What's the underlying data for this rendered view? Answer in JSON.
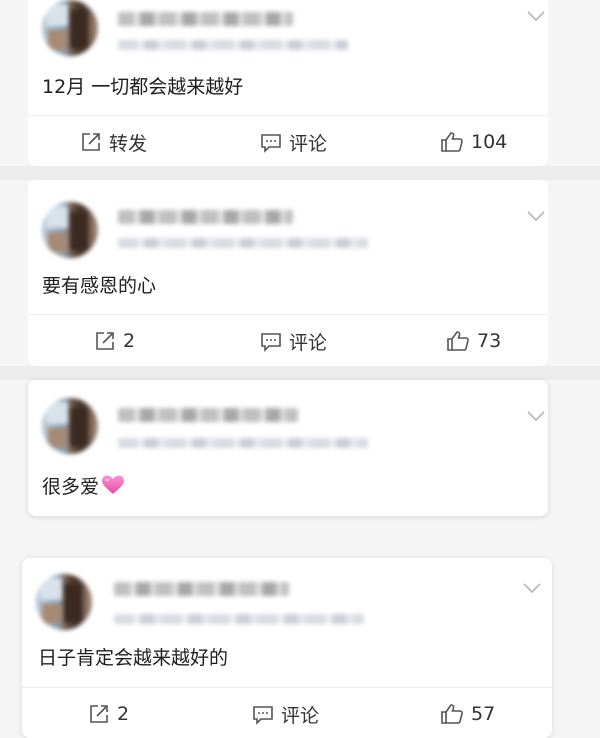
{
  "posts": [
    {
      "text": "12月 一切都会越来越好",
      "actions": {
        "repost": "转发",
        "comment": "评论",
        "like": "104"
      }
    },
    {
      "text": "要有感恩的心",
      "actions": {
        "repost": "2",
        "comment": "评论",
        "like": "73"
      }
    },
    {
      "text": "很多爱",
      "emoji": "pink-heart-emoji"
    },
    {
      "text": "日子肯定会越来越好的",
      "actions": {
        "repost": "2",
        "comment": "评论",
        "like": "57"
      }
    }
  ],
  "icons": {
    "repost": "repost-icon",
    "comment": "comment-icon",
    "like": "thumbs-up-icon",
    "menu": "chevron-down-icon"
  },
  "colors": {
    "background": "#f5f5f5",
    "card": "#ffffff",
    "text": "#1e1e1e",
    "action_text": "#333333",
    "heart": "#ee5fb6"
  }
}
